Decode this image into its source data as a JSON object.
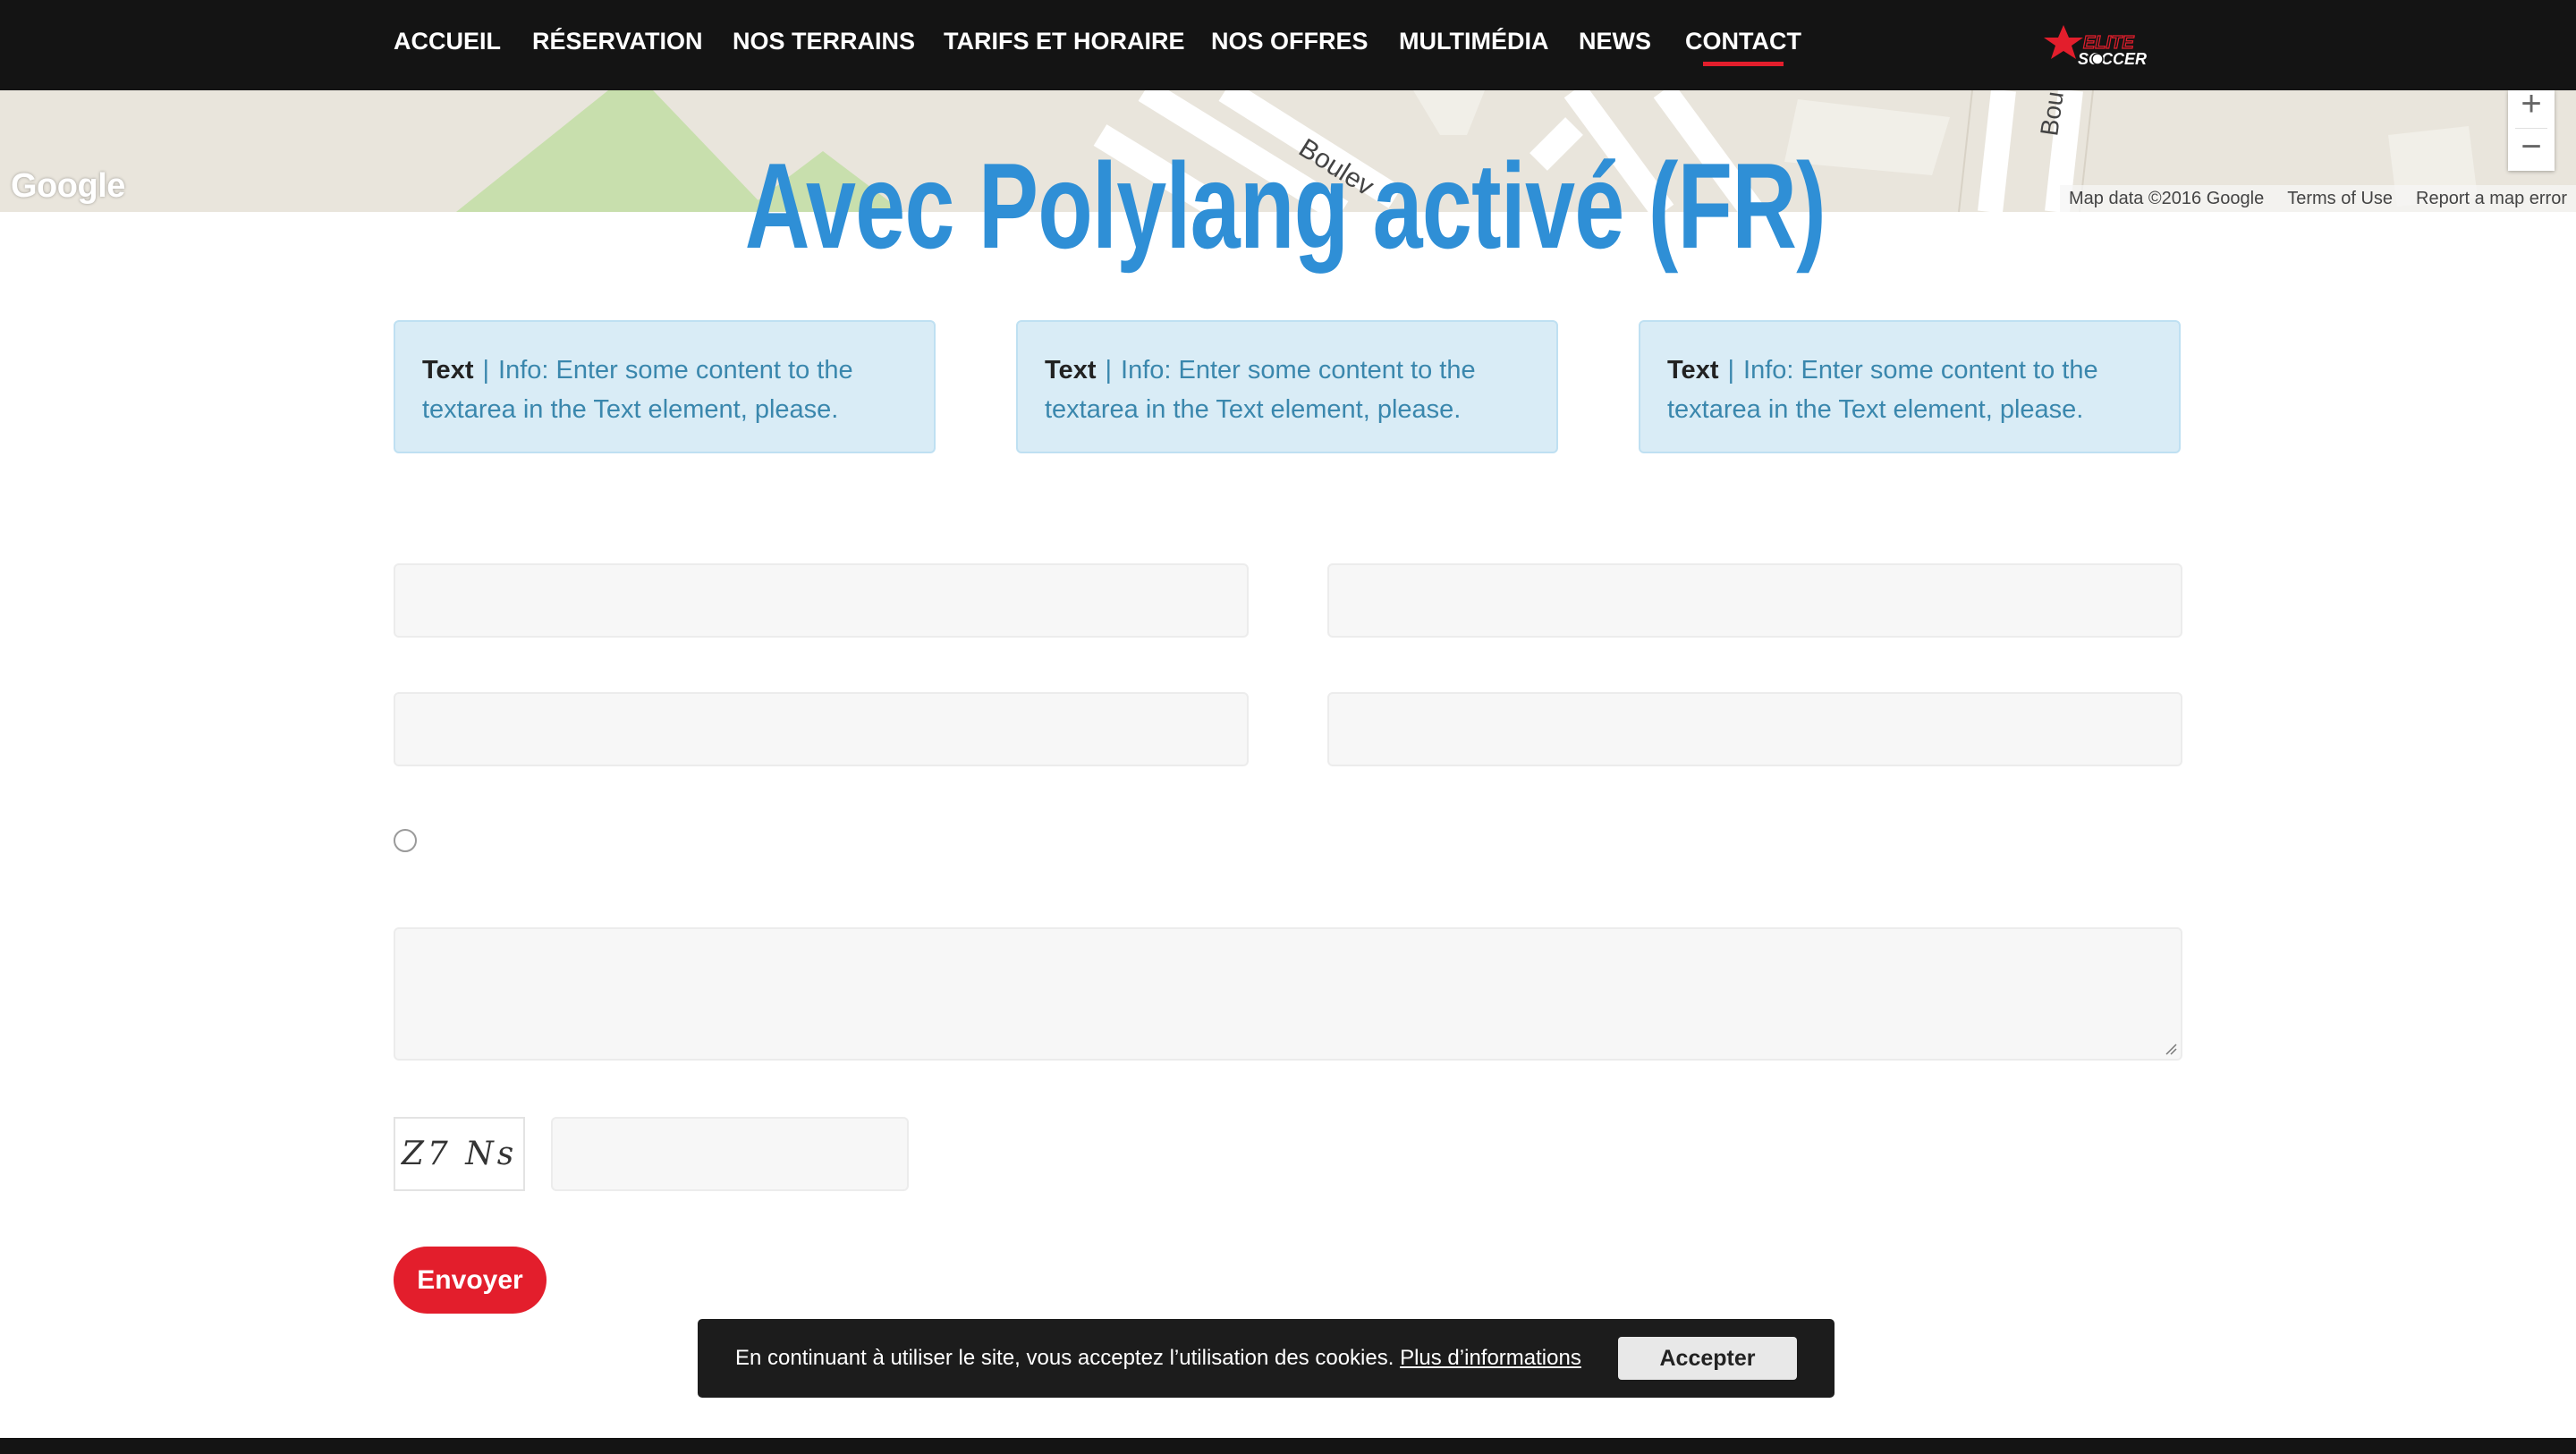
{
  "nav": {
    "items": [
      {
        "label": "ACCUEIL"
      },
      {
        "label": "RÉSERVATION"
      },
      {
        "label": "NOS TERRAINS"
      },
      {
        "label": "TARIFS ET HORAIRE"
      },
      {
        "label": "NOS OFFRES"
      },
      {
        "label": "MULTIMÉDIA"
      },
      {
        "label": "NEWS"
      },
      {
        "label": "CONTACT",
        "active": true
      }
    ],
    "logo_text": "ELITE SOCCER",
    "accent_color": "#e31e2c"
  },
  "map": {
    "google_label": "Google",
    "street_label": "Boulev",
    "street_label_2": "Bou",
    "attribution": {
      "data": "Map data ©2016 Google",
      "terms": "Terms of Use",
      "report": "Report a map error"
    },
    "zoom_in": "+",
    "zoom_out": "−"
  },
  "page": {
    "title": "Avec Polylang activé (FR)",
    "title_color": "#2f8fd6"
  },
  "info_boxes": [
    {
      "label": "Text",
      "separator": "|",
      "message": "Info: Enter some content to the textarea in the Text element, please."
    },
    {
      "label": "Text",
      "separator": "|",
      "message": "Info: Enter some content to the textarea in the Text element, please."
    },
    {
      "label": "Text",
      "separator": "|",
      "message": "Info: Enter some content to the textarea in the Text element, please."
    }
  ],
  "form": {
    "captcha_text": "Z7 Ns",
    "submit_label": "Envoyer"
  },
  "cookie_bar": {
    "message": "En continuant à utiliser le site, vous acceptez l’utilisation des cookies.",
    "link_label": "Plus d’informations",
    "accept_label": "Accepter"
  }
}
